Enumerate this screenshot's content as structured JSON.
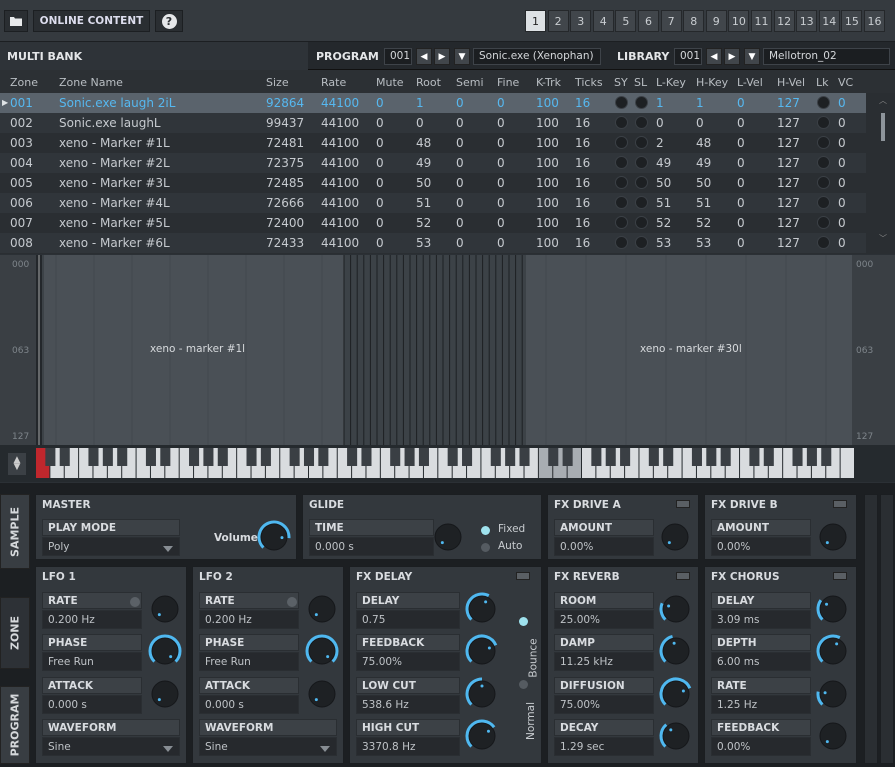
{
  "topbar": {
    "online_content": "ONLINE CONTENT",
    "help": "?",
    "banks": [
      "1",
      "2",
      "3",
      "4",
      "5",
      "6",
      "7",
      "8",
      "9",
      "10",
      "11",
      "12",
      "13",
      "14",
      "15",
      "16"
    ],
    "selected_bank": "1"
  },
  "header": {
    "multi_bank": "MULTI BANK",
    "program_label": "PROGRAM",
    "program_num": "001",
    "program_name": "Sonic.exe (Xenophan)",
    "library_label": "LIBRARY",
    "library_num": "001",
    "library_name": "Mellotron_02"
  },
  "table": {
    "columns": [
      "Zone",
      "Zone Name",
      "Size",
      "Rate",
      "Mute",
      "Root",
      "Semi",
      "Fine",
      "K-Trk",
      "Ticks",
      "SY",
      "SL",
      "L-Key",
      "H-Key",
      "L-Vel",
      "H-Vel",
      "Lk",
      "VC"
    ],
    "rows": [
      {
        "zone": "001",
        "name": "Sonic.exe laugh 2iL",
        "size": "92864",
        "rate": "44100",
        "mute": "0",
        "root": "1",
        "semi": "0",
        "fine": "0",
        "ktrk": "100",
        "ticks": "16",
        "lkey": "1",
        "hkey": "1",
        "lvel": "0",
        "hvel": "127",
        "vc": "0"
      },
      {
        "zone": "002",
        "name": "Sonic.exe laughL",
        "size": "99437",
        "rate": "44100",
        "mute": "0",
        "root": "0",
        "semi": "0",
        "fine": "0",
        "ktrk": "100",
        "ticks": "16",
        "lkey": "0",
        "hkey": "0",
        "lvel": "0",
        "hvel": "127",
        "vc": "0"
      },
      {
        "zone": "003",
        "name": "xeno - Marker #1L",
        "size": "72481",
        "rate": "44100",
        "mute": "0",
        "root": "48",
        "semi": "0",
        "fine": "0",
        "ktrk": "100",
        "ticks": "16",
        "lkey": "2",
        "hkey": "48",
        "lvel": "0",
        "hvel": "127",
        "vc": "0"
      },
      {
        "zone": "004",
        "name": "xeno - Marker #2L",
        "size": "72375",
        "rate": "44100",
        "mute": "0",
        "root": "49",
        "semi": "0",
        "fine": "0",
        "ktrk": "100",
        "ticks": "16",
        "lkey": "49",
        "hkey": "49",
        "lvel": "0",
        "hvel": "127",
        "vc": "0"
      },
      {
        "zone": "005",
        "name": "xeno - Marker #3L",
        "size": "72485",
        "rate": "44100",
        "mute": "0",
        "root": "50",
        "semi": "0",
        "fine": "0",
        "ktrk": "100",
        "ticks": "16",
        "lkey": "50",
        "hkey": "50",
        "lvel": "0",
        "hvel": "127",
        "vc": "0"
      },
      {
        "zone": "006",
        "name": "xeno - Marker #4L",
        "size": "72666",
        "rate": "44100",
        "mute": "0",
        "root": "51",
        "semi": "0",
        "fine": "0",
        "ktrk": "100",
        "ticks": "16",
        "lkey": "51",
        "hkey": "51",
        "lvel": "0",
        "hvel": "127",
        "vc": "0"
      },
      {
        "zone": "007",
        "name": "xeno - Marker #5L",
        "size": "72400",
        "rate": "44100",
        "mute": "0",
        "root": "52",
        "semi": "0",
        "fine": "0",
        "ktrk": "100",
        "ticks": "16",
        "lkey": "52",
        "hkey": "52",
        "lvel": "0",
        "hvel": "127",
        "vc": "0"
      },
      {
        "zone": "008",
        "name": "xeno - Marker #6L",
        "size": "72433",
        "rate": "44100",
        "mute": "0",
        "root": "53",
        "semi": "0",
        "fine": "0",
        "ktrk": "100",
        "ticks": "16",
        "lkey": "53",
        "hkey": "53",
        "lvel": "0",
        "hvel": "127",
        "vc": "0"
      }
    ]
  },
  "sampleview": {
    "y_top": "000",
    "y_mid": "063",
    "y_bot": "127",
    "zone_left": "xeno - marker #1l",
    "zone_right": "xeno - marker #30l"
  },
  "tabs": {
    "sample": "SAMPLE",
    "zone": "ZONE",
    "program": "PROGRAM"
  },
  "master": {
    "title": "MASTER",
    "play_mode_label": "PLAY MODE",
    "play_mode_value": "Poly",
    "volume_label": "Volume"
  },
  "glide": {
    "title": "GLIDE",
    "time_label": "TIME",
    "time_value": "0.000 s",
    "fixed": "Fixed",
    "auto": "Auto"
  },
  "fx_drive_a": {
    "title": "FX DRIVE A",
    "amount_label": "AMOUNT",
    "amount_value": "0.00%"
  },
  "fx_drive_b": {
    "title": "FX DRIVE B",
    "amount_label": "AMOUNT",
    "amount_value": "0.00%"
  },
  "lfo1": {
    "title": "LFO 1",
    "rate_label": "RATE",
    "rate_value": "0.200 Hz",
    "phase_label": "PHASE",
    "phase_value": "Free Run",
    "attack_label": "ATTACK",
    "attack_value": "0.000 s",
    "waveform_label": "WAVEFORM",
    "waveform_value": "Sine"
  },
  "lfo2": {
    "title": "LFO 2",
    "rate_label": "RATE",
    "rate_value": "0.200 Hz",
    "phase_label": "PHASE",
    "phase_value": "Free Run",
    "attack_label": "ATTACK",
    "attack_value": "0.000 s",
    "waveform_label": "WAVEFORM",
    "waveform_value": "Sine"
  },
  "fx_delay": {
    "title": "FX DELAY",
    "delay_label": "DELAY",
    "delay_value": "0.75",
    "feedback_label": "FEEDBACK",
    "feedback_value": "75.00%",
    "lowcut_label": "LOW CUT",
    "lowcut_value": "538.6 Hz",
    "highcut_label": "HIGH CUT",
    "highcut_value": "3370.8 Hz",
    "bounce": "Bounce",
    "normal": "Normal"
  },
  "fx_reverb": {
    "title": "FX REVERB",
    "room_label": "ROOM",
    "room_value": "25.00%",
    "damp_label": "DAMP",
    "damp_value": "11.25 kHz",
    "diffusion_label": "DIFFUSION",
    "diffusion_value": "75.00%",
    "decay_label": "DECAY",
    "decay_value": "1.29 sec"
  },
  "fx_chorus": {
    "title": "FX CHORUS",
    "delay_label": "DELAY",
    "delay_value": "3.09 ms",
    "depth_label": "DEPTH",
    "depth_value": "6.00 ms",
    "rate_label": "RATE",
    "rate_value": "1.25 Hz",
    "feedback_label": "FEEDBACK",
    "feedback_value": "0.00%"
  },
  "colors": {
    "accent": "#4fb8f0",
    "panel": "#33383d",
    "selected_row": "#5a636c"
  }
}
